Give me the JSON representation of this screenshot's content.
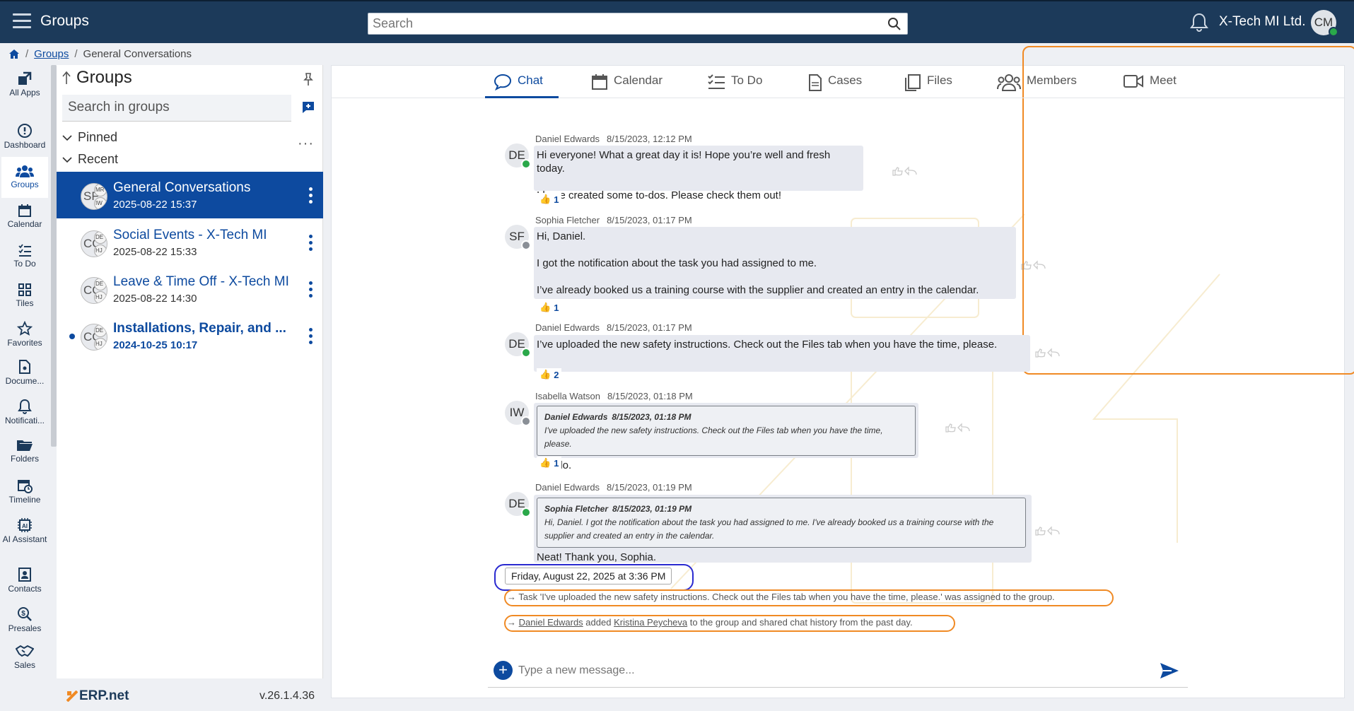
{
  "topbar": {
    "title": "Groups",
    "search_placeholder": "Search",
    "company": "X-Tech MI Ltd.",
    "user_initials": "CM"
  },
  "breadcrumb": {
    "items": [
      "Groups",
      "General Conversations"
    ]
  },
  "nav": {
    "items": [
      {
        "label": "All Apps",
        "icon": "all-apps-icon"
      },
      {
        "label": "Dashboard",
        "icon": "dashboard-icon"
      },
      {
        "label": "Groups",
        "icon": "groups-icon"
      },
      {
        "label": "Calendar",
        "icon": "calendar-icon"
      },
      {
        "label": "To Do",
        "icon": "todo-icon"
      },
      {
        "label": "Tiles",
        "icon": "tiles-icon"
      },
      {
        "label": "Favorites",
        "icon": "star-icon"
      },
      {
        "label": "Docume...",
        "icon": "document-icon"
      },
      {
        "label": "Notificati...",
        "icon": "bell-icon"
      },
      {
        "label": "Folders",
        "icon": "folder-icon"
      },
      {
        "label": "Timeline",
        "icon": "timeline-icon"
      },
      {
        "label": "AI Assistant",
        "icon": "ai-icon"
      },
      {
        "label": "Contacts",
        "icon": "contacts-icon"
      },
      {
        "label": "Presales",
        "icon": "presales-icon"
      },
      {
        "label": "Sales",
        "icon": "sales-icon"
      }
    ]
  },
  "groups_panel": {
    "title": "Groups",
    "search_placeholder": "Search in groups",
    "pinned_label": "Pinned",
    "recent_label": "Recent",
    "groups": [
      {
        "name": "General Conversations",
        "date": "2025-08-22 15:37",
        "initials": "SF"
      },
      {
        "name": "Social Events - X-Tech MI",
        "date": "2025-08-22 15:33",
        "initials": "CC"
      },
      {
        "name": "Leave & Time Off - X-Tech MI",
        "date": "2025-08-22 14:30",
        "initials": "CC"
      },
      {
        "name": "Installations, Repair, and ...",
        "date": "2024-10-25 10:17",
        "initials": "CC"
      }
    ],
    "logo": "ERP.net",
    "version": "v.26.1.4.36"
  },
  "tabs": [
    {
      "label": "Chat",
      "icon": "chat-icon"
    },
    {
      "label": "Calendar",
      "icon": "calendar-icon"
    },
    {
      "label": "To Do",
      "icon": "todo-icon"
    },
    {
      "label": "Cases",
      "icon": "cases-icon"
    },
    {
      "label": "Files",
      "icon": "files-icon"
    },
    {
      "label": "Members",
      "icon": "members-icon"
    },
    {
      "label": "Meet",
      "icon": "meet-icon"
    }
  ],
  "messages": [
    {
      "author": "Daniel Edwards",
      "time": "8/15/2023, 12:12 PM",
      "initials": "DE",
      "lines": [
        "Hi everyone! What a great day it is! Hope you’re well and fresh today.",
        "I have created some to-dos. Please check them out!"
      ],
      "likes": "1"
    },
    {
      "author": "Sophia Fletcher",
      "time": "8/15/2023, 01:17 PM",
      "initials": "SF",
      "lines": [
        "Hi, Daniel.",
        "I got the notification about the task you had assigned to me.",
        "I’ve already booked us a training course with the supplier and created an entry in the calendar."
      ],
      "likes": "1"
    },
    {
      "author": "Daniel Edwards",
      "time": "8/15/2023, 01:17 PM",
      "initials": "DE",
      "lines": [
        "I’ve uploaded the new safety instructions. Check out the Files tab when you have the time, please."
      ],
      "likes": "2"
    },
    {
      "author": "Isabella Watson",
      "time": "8/15/2023, 01:18 PM",
      "initials": "IW",
      "quote_author": "Daniel Edwards",
      "quote_time": "8/15/2023, 01:18 PM",
      "quote_text": "I've uploaded the new safety instructions. Check out the Files tab when you have the time, please.",
      "lines": [
        "Will do."
      ],
      "likes": "1"
    },
    {
      "author": "Daniel Edwards",
      "time": "8/15/2023, 01:19 PM",
      "initials": "DE",
      "quote_author": "Sophia Fletcher",
      "quote_time": "8/15/2023, 01:19 PM",
      "quote_text": "Hi, Daniel. I got the notification about the task you had assigned to me. I've already booked us a training course with the supplier and created an entry in the calendar.",
      "lines": [
        "Neat! Thank you, Sophia."
      ]
    }
  ],
  "date_divider": "Friday, August 22, 2025 at 3:36 PM",
  "system": {
    "task_msg": "Task 'I've uploaded the new safety instructions. Check out the Files tab when you have the time, please.' was assigned to the group.",
    "added_user": "Daniel Edwards",
    "added_word": "added",
    "added_target": "Kristina Peycheva",
    "added_tail": "to the group and shared chat history from the past day."
  },
  "composer": {
    "placeholder": "Type a new message..."
  },
  "colors": {
    "brand": "#0d4a9f",
    "topbar": "#1c3a5a",
    "annotation_orange": "#f08a24",
    "annotation_blue": "#2a2ad0"
  }
}
